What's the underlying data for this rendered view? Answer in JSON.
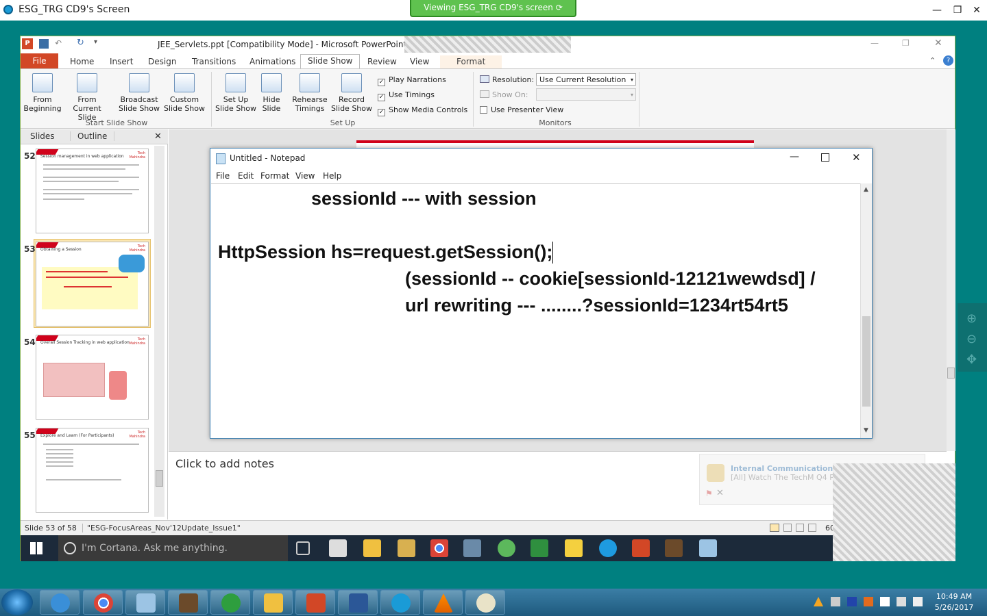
{
  "outer_window": {
    "title": "ESG_TRG CD9's Screen",
    "viewing_banner": "Viewing ESG_TRG CD9's screen"
  },
  "powerpoint": {
    "title": "JEE_Servlets.ppt [Compatibility Mode]  -  Microsoft PowerPoint",
    "tabs": [
      "File",
      "Home",
      "Insert",
      "Design",
      "Transitions",
      "Animations",
      "Slide Show",
      "Review",
      "View",
      "Format"
    ],
    "ribbon": {
      "from_beginning": "From Beginning",
      "from_current": "From Current Slide",
      "broadcast": "Broadcast Slide Show",
      "custom": "Custom Slide Show",
      "group_start": "Start Slide Show",
      "setup_show": "Set Up Slide Show",
      "hide_slide": "Hide Slide",
      "rehearse": "Rehearse Timings",
      "record": "Record Slide Show",
      "play_narrations": "Play Narrations",
      "use_timings": "Use Timings",
      "show_media": "Show Media Controls",
      "group_setup": "Set Up",
      "resolution_label": "Resolution:",
      "resolution_value": "Use Current Resolution",
      "show_on_label": "Show On:",
      "use_presenter": "Use Presenter View",
      "group_monitors": "Monitors"
    },
    "panel_tabs": [
      "Slides",
      "Outline"
    ],
    "slides": [
      {
        "num": "52",
        "title": "Session management in web application"
      },
      {
        "num": "53",
        "title": "Obtaining a Session"
      },
      {
        "num": "54",
        "title": "Overall Session Tracking in web application"
      },
      {
        "num": "55",
        "title": "Explore and Learn (For Participants)"
      }
    ],
    "notes_placeholder": "Click to add notes",
    "status_slide": "Slide 53 of 58",
    "status_theme": "\"ESG-FocusAreas_Nov'12Update_Issue1\"",
    "zoom": "60"
  },
  "taskbar": {
    "cortana": "I'm Cortana. Ask me anything."
  },
  "notepad": {
    "title": "Untitled - Notepad",
    "menus": [
      "File",
      "Edit",
      "Format",
      "View",
      "Help"
    ],
    "lines": [
      "sessionId --- with session",
      "HttpSession hs=request.getSession();",
      "(sessionId -- cookie[sessionId-12121wewdsd] /",
      "url rewriting --- ........?sessionId=1234rt54rt5"
    ]
  },
  "toast": {
    "title": "Internal Communications",
    "body": "[All] Watch The TechM Q4 Res"
  },
  "clock": {
    "time": "10:49 AM",
    "date": "5/26/2017"
  },
  "colors": {
    "file_tab": "#d24726",
    "viewing_banner": "#5fc24f",
    "teal_bg": "#008080"
  }
}
